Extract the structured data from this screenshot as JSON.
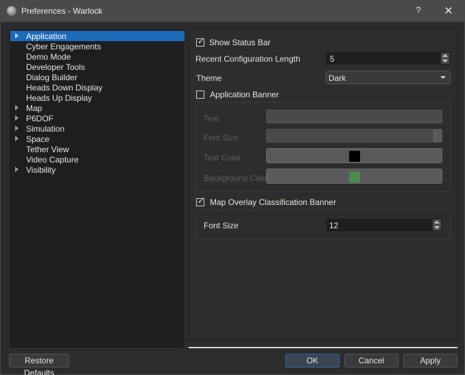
{
  "window": {
    "title": "Preferences - Warlock",
    "help_label": "?",
    "close_label": "✕"
  },
  "tree": {
    "items": [
      {
        "label": "Application",
        "expandable": true,
        "selected": true
      },
      {
        "label": "Cyber Engagements",
        "expandable": false,
        "selected": false
      },
      {
        "label": "Demo Mode",
        "expandable": false,
        "selected": false
      },
      {
        "label": "Developer Tools",
        "expandable": false,
        "selected": false
      },
      {
        "label": "Dialog Builder",
        "expandable": false,
        "selected": false
      },
      {
        "label": "Heads Down Display",
        "expandable": false,
        "selected": false
      },
      {
        "label": "Heads Up Display",
        "expandable": false,
        "selected": false
      },
      {
        "label": "Map",
        "expandable": true,
        "selected": false
      },
      {
        "label": "P6DOF",
        "expandable": true,
        "selected": false
      },
      {
        "label": "Simulation",
        "expandable": true,
        "selected": false
      },
      {
        "label": "Space",
        "expandable": true,
        "selected": false
      },
      {
        "label": "Tether View",
        "expandable": false,
        "selected": false
      },
      {
        "label": "Video Capture",
        "expandable": false,
        "selected": false
      },
      {
        "label": "Visibility",
        "expandable": true,
        "selected": false
      }
    ]
  },
  "application": {
    "show_status_bar": {
      "label": "Show Status Bar",
      "checked": true
    },
    "recent_config_length": {
      "label": "Recent Configuration Length",
      "value": "5"
    },
    "theme": {
      "label": "Theme",
      "value": "Dark"
    },
    "app_banner": {
      "label": "Application Banner",
      "checked": false,
      "text_label": "Text",
      "text_value": "",
      "font_size_label": "Font Size",
      "font_size_value": "",
      "text_color_label": "Text Color",
      "text_color": "#000000",
      "bg_color_label": "Background Color",
      "bg_color": "#4a8a4a"
    },
    "map_overlay_banner": {
      "label": "Map Overlay Classification Banner",
      "checked": true,
      "font_size_label": "Font Size",
      "font_size_value": "12"
    }
  },
  "buttons": {
    "restore_defaults": "Restore Defaults",
    "ok": "OK",
    "cancel": "Cancel",
    "apply": "Apply"
  },
  "check_glyph": "✓"
}
